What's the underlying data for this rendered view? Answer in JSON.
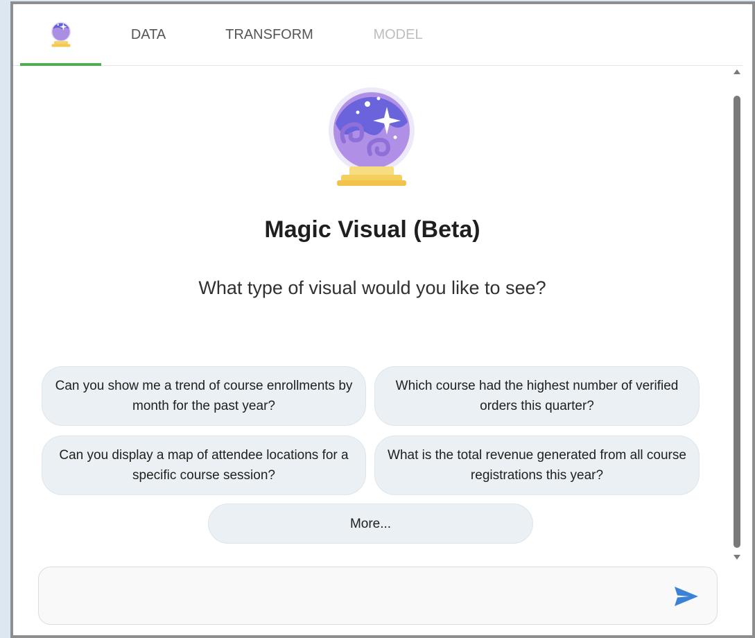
{
  "tabs": {
    "data_label": "DATA",
    "transform_label": "TRANSFORM",
    "model_label": "MODEL"
  },
  "hero": {
    "title": "Magic Visual (Beta)",
    "subtitle": "What type of visual would you like to see?"
  },
  "suggestions": [
    {
      "text": "Can you show me a trend of course enrollments by month for the past year?"
    },
    {
      "text": "Which course had the highest number of verified orders this quarter?"
    },
    {
      "text": "Can you display a map of attendee locations for a specific course session?"
    },
    {
      "text": "What is the total revenue generated from all course registrations this year?"
    }
  ],
  "more_label": "More...",
  "chat": {
    "value": "",
    "placeholder": ""
  },
  "icons": {
    "tab_icon": "crystal-ball-icon",
    "hero_icon": "crystal-ball-icon",
    "send_icon": "send-icon"
  },
  "colors": {
    "active_tab_underline": "#4caf50",
    "send_icon": "#3b82d6",
    "pill_background": "#eaf0f3"
  }
}
